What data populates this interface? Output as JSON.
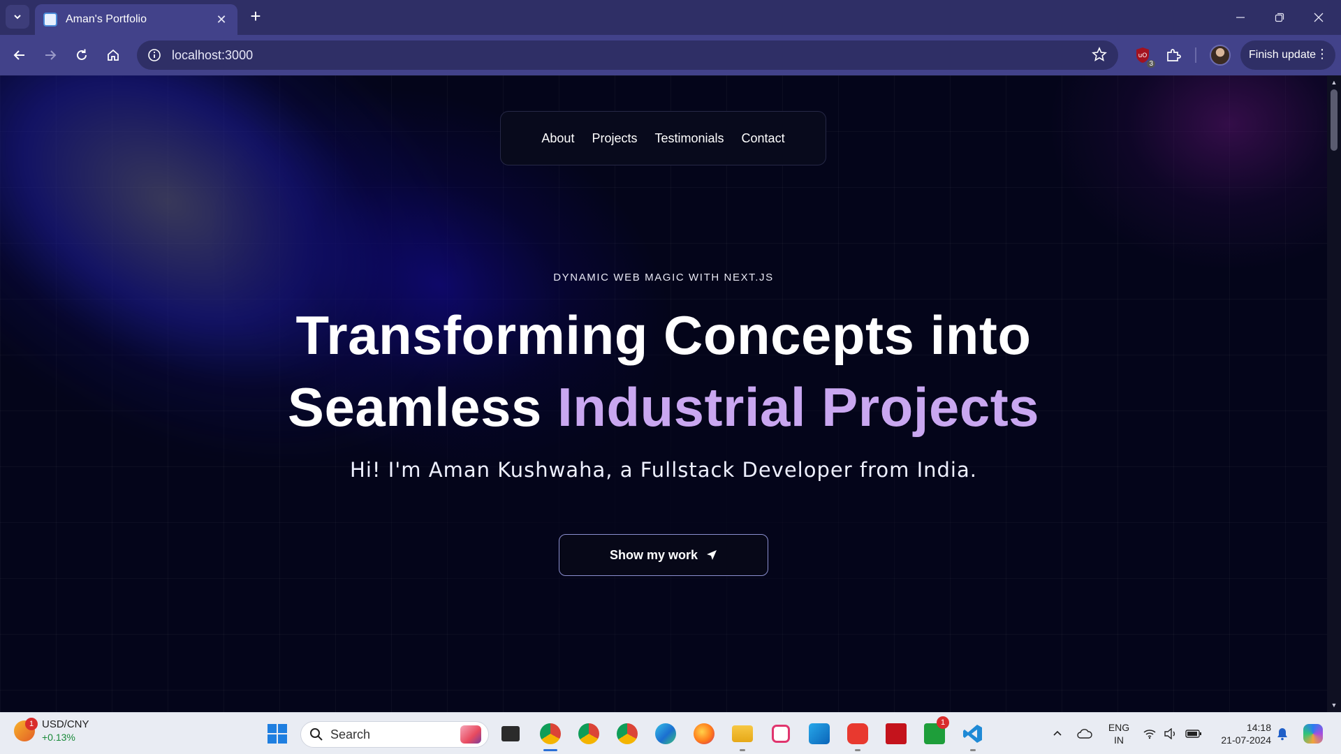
{
  "browser": {
    "tab_title": "Aman's Portfolio",
    "url": "localhost:3000",
    "finish_update_label": "Finish update",
    "extension_badge": "3"
  },
  "nav": {
    "links": [
      "About",
      "Projects",
      "Testimonials",
      "Contact"
    ]
  },
  "hero": {
    "eyebrow": "DYNAMIC WEB MAGIC WITH NEXT.JS",
    "title_line1": "Transforming Concepts into",
    "title_line2_plain": "Seamless ",
    "title_line2_accent": "Industrial Projects",
    "subtitle": "Hi! I'm Aman Kushwaha, a Fullstack Developer from India.",
    "cta_label": "Show my work"
  },
  "colors": {
    "page_bg": "#04051a",
    "accent": "#c9a7f0",
    "browser_frame": "#42428a"
  },
  "taskbar": {
    "weather_badge": "1",
    "ticker": "USD/CNY",
    "ticker_change": "+0.13%",
    "search_placeholder": "Search",
    "xbox_badge": "1",
    "lang_line1": "ENG",
    "lang_line2": "IN",
    "time": "14:18",
    "date": "21-07-2024"
  }
}
